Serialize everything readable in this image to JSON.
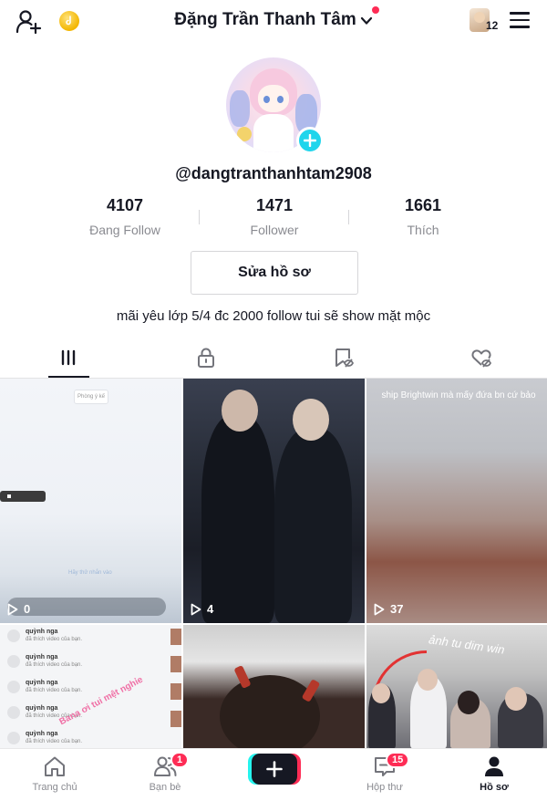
{
  "header": {
    "title": "Đặng Trần Thanh Tâm",
    "friend_count": "12",
    "icons": [
      "add-user-icon",
      "coin-icon",
      "chevron-down-icon",
      "menu-icon"
    ]
  },
  "profile": {
    "username": "@dangtranthanhtam2908",
    "stats": [
      {
        "value": "4107",
        "label": "Đang Follow"
      },
      {
        "value": "1471",
        "label": "Follower"
      },
      {
        "value": "1661",
        "label": "Thích"
      }
    ],
    "edit_button": "Sửa hồ sơ",
    "bio": "mãi yêu lớp 5/4 đc 2000 follow tui sẽ show mặt mộc"
  },
  "tabs": [
    {
      "name": "videos",
      "icon": "grid-icon",
      "active": true
    },
    {
      "name": "private",
      "icon": "lock-icon"
    },
    {
      "name": "bookmarks",
      "icon": "bookmark-icon"
    },
    {
      "name": "liked",
      "icon": "heart-icon"
    }
  ],
  "videos": [
    {
      "views": "0",
      "chip": "Phòng ý kế",
      "footer": "Hãy thử nhắn vào"
    },
    {
      "views": "4"
    },
    {
      "views": "37",
      "caption": "ship Brightwin mà mấy đứa bn cứ bảo"
    },
    {
      "name_a": "quỳnh nga",
      "line_b": "đã thích video của bạn.",
      "overlay": "Bana ơi tui mệt nghỉe"
    },
    {},
    {
      "caption": "ảnh tu dim win"
    }
  ],
  "bottom_nav": [
    {
      "label": "Trang chủ",
      "icon": "home-icon"
    },
    {
      "label": "Bạn bè",
      "icon": "friends-icon",
      "badge": "1"
    },
    {
      "label": "",
      "icon": "plus-icon"
    },
    {
      "label": "Hộp thư",
      "icon": "inbox-icon",
      "badge": "15"
    },
    {
      "label": "Hồ sơ",
      "icon": "profile-icon",
      "active": true
    }
  ],
  "colors": {
    "accent": "#fe2c55",
    "cyan": "#25f4ee",
    "plus": "#20d5ec"
  }
}
